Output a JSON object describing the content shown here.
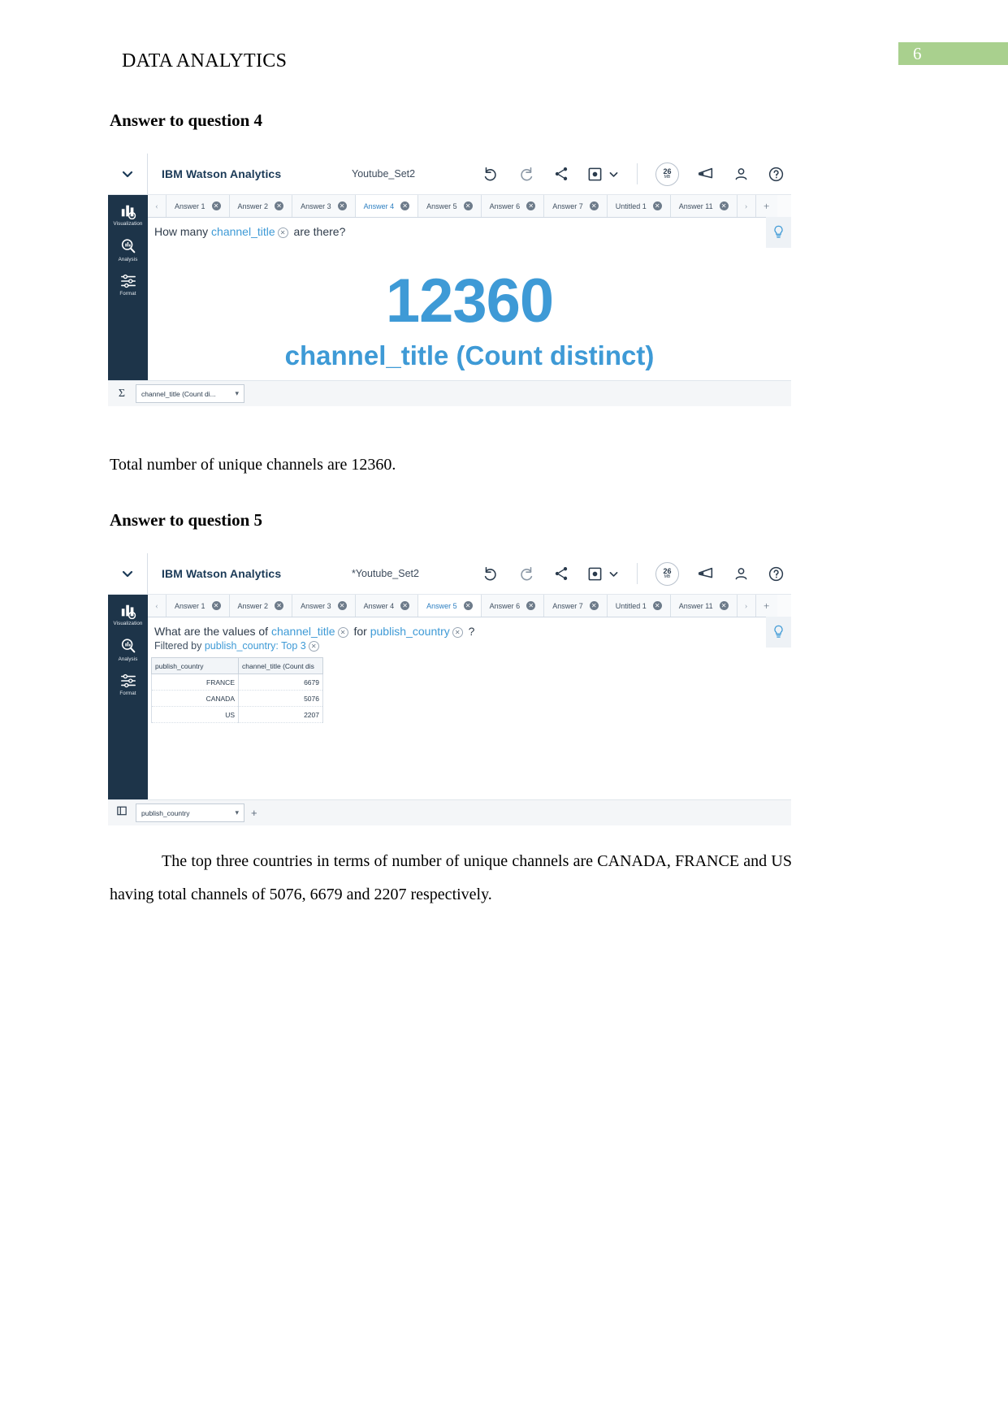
{
  "document": {
    "running_header": "DATA ANALYTICS",
    "page_number": "6",
    "page_badge_color": "#a9d08e",
    "heading_q4": "Answer to question 4",
    "heading_q5": "Answer to question 5",
    "paragraph_q4": "Total number of unique channels are 12360.",
    "paragraph_q5": "The top three countries in terms of number of unique channels are CANADA, FRANCE and US having total channels of 5076, 6679 and 2207 respectively."
  },
  "shot1": {
    "brand": "IBM Watson Analytics",
    "dataset_name": "Youtube_Set2",
    "toolbar": {
      "undo": "undo-icon",
      "redo": "redo-icon",
      "share": "share-icon",
      "save": "save-icon",
      "save_caret": "chevron-down-icon",
      "storage_value": "26",
      "storage_unit": "MB",
      "announcements": "megaphone-icon",
      "account": "user-icon",
      "help": "help-icon"
    },
    "rail": [
      {
        "label": "Visualization",
        "icon": "bar-chart-icon"
      },
      {
        "label": "Analysis",
        "icon": "magnifier-chart-icon"
      },
      {
        "label": "Format",
        "icon": "sliders-icon"
      }
    ],
    "tabs": [
      {
        "label": "Answer 1",
        "active": false
      },
      {
        "label": "Answer 2",
        "active": false
      },
      {
        "label": "Answer 3",
        "active": false
      },
      {
        "label": "Answer 4",
        "active": true
      },
      {
        "label": "Answer 5",
        "active": false
      },
      {
        "label": "Answer 6",
        "active": false
      },
      {
        "label": "Answer 7",
        "active": false
      },
      {
        "label": "Untitled 1",
        "active": false
      },
      {
        "label": "Answer 11",
        "active": false
      }
    ],
    "question": {
      "prefix": "How many",
      "token": "channel_title",
      "suffix": "are there?"
    },
    "visual": {
      "value": "12360",
      "caption": "channel_title (Count distinct)",
      "accent_color": "#3e9ad6"
    },
    "footer": {
      "sigma": "Σ",
      "field": "channel_title (Count di..."
    }
  },
  "shot2": {
    "brand": "IBM Watson Analytics",
    "dataset_name": "*Youtube_Set2",
    "toolbar": {
      "undo": "undo-icon",
      "redo": "redo-icon",
      "share": "share-icon",
      "save": "save-icon",
      "save_caret": "chevron-down-icon",
      "storage_value": "26",
      "storage_unit": "MB",
      "announcements": "megaphone-icon",
      "account": "user-icon",
      "help": "help-icon"
    },
    "rail": [
      {
        "label": "Visualization",
        "icon": "bar-chart-icon"
      },
      {
        "label": "Analysis",
        "icon": "magnifier-chart-icon"
      },
      {
        "label": "Format",
        "icon": "sliders-icon"
      }
    ],
    "tabs": [
      {
        "label": "Answer 1",
        "active": false
      },
      {
        "label": "Answer 2",
        "active": false
      },
      {
        "label": "Answer 3",
        "active": false
      },
      {
        "label": "Answer 4",
        "active": false
      },
      {
        "label": "Answer 5",
        "active": true
      },
      {
        "label": "Answer 6",
        "active": false
      },
      {
        "label": "Answer 7",
        "active": false
      },
      {
        "label": "Untitled 1",
        "active": false
      },
      {
        "label": "Answer 11",
        "active": false
      }
    ],
    "question": {
      "prefix": "What are the values of",
      "token1": "channel_title",
      "middle": "for",
      "token2": "publish_country",
      "suffix": "?"
    },
    "filter": {
      "prefix": "Filtered by",
      "token": "publish_country: Top 3"
    },
    "footer": {
      "field": "publish_country",
      "plus": "+"
    },
    "table": {
      "columns": [
        "publish_country",
        "channel_title (Count dis"
      ],
      "rows": [
        {
          "country": "FRANCE",
          "count": "6679"
        },
        {
          "country": "CANADA",
          "count": "5076"
        },
        {
          "country": "US",
          "count": "2207"
        }
      ]
    }
  }
}
